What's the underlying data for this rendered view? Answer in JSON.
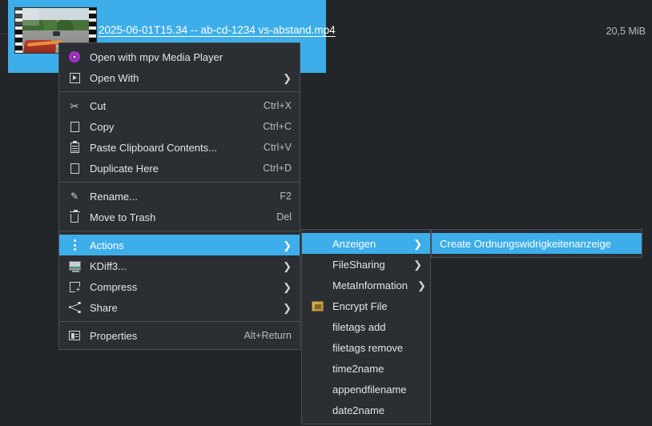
{
  "file": {
    "name": "2025-06-01T15.34 -- ab-cd-1234 vs-abstand.mp4",
    "size": "20,5 MiB",
    "thumbnail_icon": "video-film-thumbnail"
  },
  "context_menu": {
    "items": [
      {
        "label": "Open with mpv Media Player",
        "icon": "mpv-icon",
        "accel": "",
        "submenu": false,
        "selected": false
      },
      {
        "label": "Open With",
        "icon": "open-with-icon",
        "accel": "",
        "submenu": true,
        "selected": false
      },
      {
        "separator": true
      },
      {
        "label": "Cut",
        "icon": "scissors-icon",
        "accel": "Ctrl+X",
        "submenu": false,
        "selected": false
      },
      {
        "label": "Copy",
        "icon": "copy-icon",
        "accel": "Ctrl+C",
        "submenu": false,
        "selected": false
      },
      {
        "label": "Paste Clipboard Contents...",
        "icon": "clipboard-icon",
        "accel": "Ctrl+V",
        "submenu": false,
        "selected": false
      },
      {
        "label": "Duplicate Here",
        "icon": "duplicate-icon",
        "accel": "Ctrl+D",
        "submenu": false,
        "selected": false
      },
      {
        "separator": true
      },
      {
        "label": "Rename...",
        "icon": "pencil-icon",
        "accel": "F2",
        "submenu": false,
        "selected": false
      },
      {
        "label": "Move to Trash",
        "icon": "trash-icon",
        "accel": "Del",
        "submenu": false,
        "selected": false
      },
      {
        "separator": true
      },
      {
        "label": "Actions",
        "icon": "three-dots-icon",
        "accel": "",
        "submenu": true,
        "selected": true
      },
      {
        "label": "KDiff3...",
        "icon": "monitor-icon",
        "accel": "",
        "submenu": true,
        "selected": false
      },
      {
        "label": "Compress",
        "icon": "compress-icon",
        "accel": "",
        "submenu": true,
        "selected": false
      },
      {
        "label": "Share",
        "icon": "share-icon",
        "accel": "",
        "submenu": true,
        "selected": false
      },
      {
        "separator": true
      },
      {
        "label": "Properties",
        "icon": "properties-icon",
        "accel": "Alt+Return",
        "submenu": false,
        "selected": false
      }
    ]
  },
  "actions_submenu": {
    "items": [
      {
        "label": "Anzeigen",
        "icon": "",
        "submenu": true,
        "selected": true
      },
      {
        "label": "FileSharing",
        "icon": "",
        "submenu": true,
        "selected": false
      },
      {
        "label": "MetaInformation",
        "icon": "",
        "submenu": true,
        "selected": false
      },
      {
        "label": "Encrypt File",
        "icon": "encrypt-icon",
        "submenu": false,
        "selected": false
      },
      {
        "label": "filetags add",
        "icon": "",
        "submenu": false,
        "selected": false
      },
      {
        "label": "filetags remove",
        "icon": "",
        "submenu": false,
        "selected": false
      },
      {
        "label": "time2name",
        "icon": "",
        "submenu": false,
        "selected": false
      },
      {
        "label": "appendfilename",
        "icon": "",
        "submenu": false,
        "selected": false
      },
      {
        "label": "date2name",
        "icon": "",
        "submenu": false,
        "selected": false
      }
    ]
  },
  "anzeigen_submenu": {
    "items": [
      {
        "label": "Create Ordnungswidrigkeitenanzeige",
        "icon": "",
        "submenu": false,
        "selected": true
      }
    ]
  },
  "colors": {
    "background": "#232629",
    "menu_background": "#2b2e32",
    "highlight": "#3daee9",
    "text": "#e3e6e8",
    "accel_text": "#b8bdc2",
    "separator": "#4a4f55"
  }
}
